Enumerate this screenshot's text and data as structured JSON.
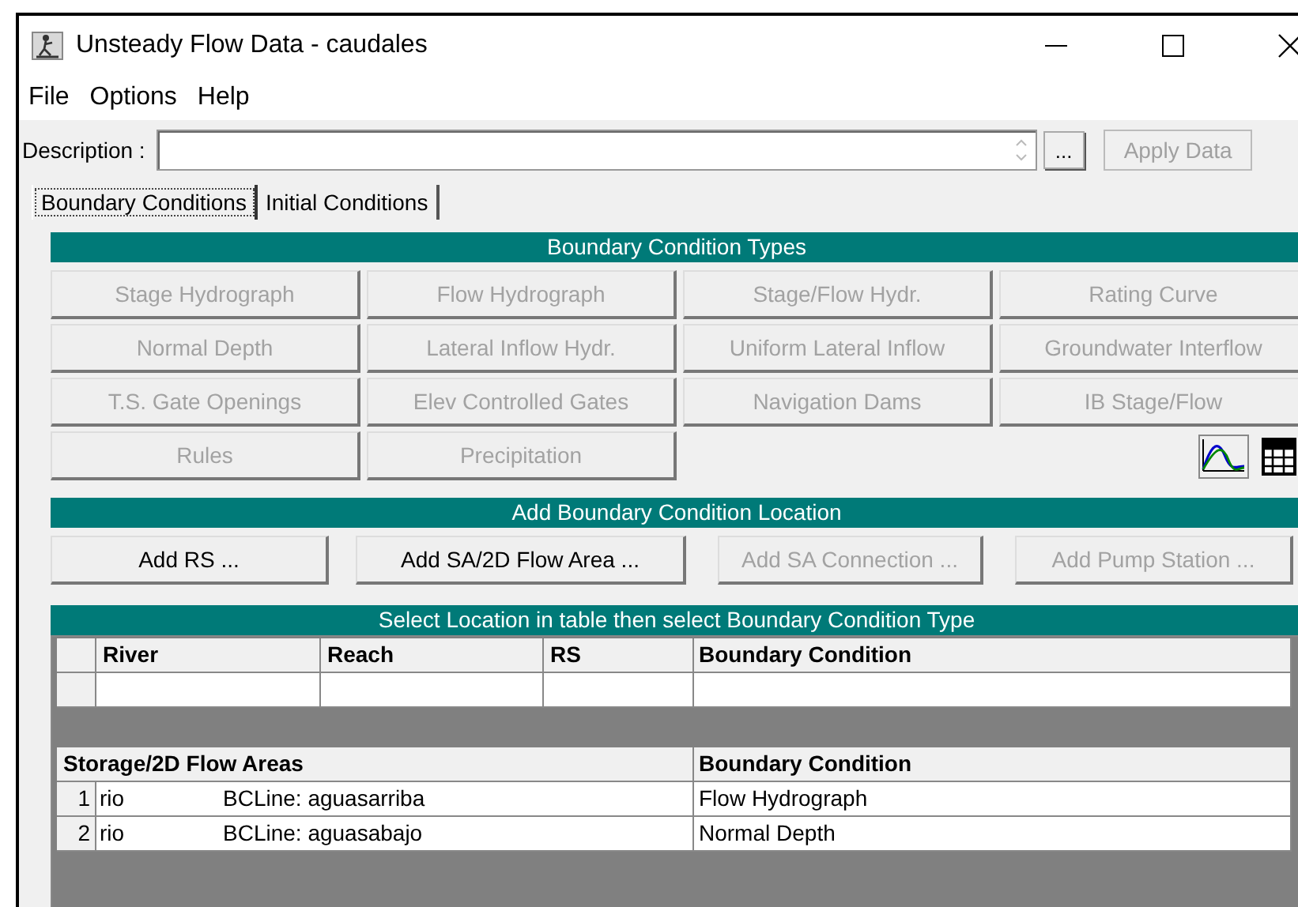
{
  "window": {
    "title": "Unsteady Flow Data - caudales"
  },
  "menu": [
    "File",
    "Options",
    "Help"
  ],
  "description": {
    "label": "Description :",
    "browse_button": "...",
    "apply_button": {
      "label": "Apply Data",
      "disabled": true
    }
  },
  "tabs": [
    {
      "label": "Boundary Conditions",
      "selected": true
    },
    {
      "label": "Initial Conditions",
      "selected": false
    }
  ],
  "boundary_condition_types": {
    "title": "Boundary Condition Types",
    "buttons": [
      {
        "label": "Stage Hydrograph",
        "disabled": true
      },
      {
        "label": "Flow Hydrograph",
        "disabled": true
      },
      {
        "label": "Stage/Flow Hydr.",
        "disabled": true
      },
      {
        "label": "Rating Curve",
        "disabled": true
      },
      {
        "label": "Normal Depth",
        "disabled": true
      },
      {
        "label": "Lateral Inflow Hydr.",
        "disabled": true
      },
      {
        "label": "Uniform Lateral Inflow",
        "disabled": true
      },
      {
        "label": "Groundwater Interflow",
        "disabled": true
      },
      {
        "label": "T.S. Gate Openings",
        "disabled": true
      },
      {
        "label": "Elev Controlled Gates",
        "disabled": true
      },
      {
        "label": "Navigation Dams",
        "disabled": true
      },
      {
        "label": "IB Stage/Flow",
        "disabled": true
      },
      {
        "label": "Rules",
        "disabled": true
      },
      {
        "label": "Precipitation",
        "disabled": true
      }
    ]
  },
  "add_location": {
    "title": "Add Boundary Condition Location",
    "buttons": [
      {
        "label": "Add RS ...",
        "disabled": false
      },
      {
        "label": "Add SA/2D Flow Area ...",
        "disabled": false
      },
      {
        "label": "Add SA Connection ...",
        "disabled": true
      },
      {
        "label": "Add Pump Station ...",
        "disabled": true
      }
    ]
  },
  "location_table": {
    "title": "Select Location in table then select Boundary Condition Type",
    "columns": [
      "River",
      "Reach",
      "RS",
      "Boundary Condition"
    ],
    "storage_columns": [
      "Storage/2D Flow Areas",
      "Boundary Condition"
    ],
    "storage_rows": [
      {
        "number": "1",
        "area": "rio",
        "bc_line": "BCLine: aguasarriba",
        "boundary_condition": "Flow Hydrograph"
      },
      {
        "number": "2",
        "area": "rio",
        "bc_line": "BCLine: aguasabajo",
        "boundary_condition": "Normal Depth"
      }
    ]
  }
}
